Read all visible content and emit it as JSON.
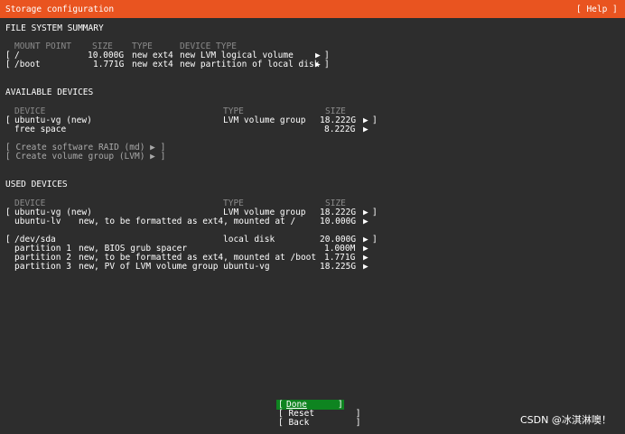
{
  "header": {
    "title": "Storage configuration",
    "help_label": "[ Help ]"
  },
  "fs_summary": {
    "heading": "FILE SYSTEM SUMMARY",
    "col_mount": "MOUNT POINT",
    "col_size": "SIZE",
    "col_type": "TYPE",
    "col_device_type": "DEVICE TYPE",
    "rows": [
      {
        "bracket_open": "[",
        "mount": "/",
        "size": "10.000G",
        "type": "new ext4",
        "device_type": "new LVM logical volume",
        "arrow": "▶",
        "bracket_close": "]"
      },
      {
        "bracket_open": "[",
        "mount": "/boot",
        "size": "1.771G",
        "type": "new ext4",
        "device_type": "new partition of local disk",
        "arrow": "▶",
        "bracket_close": "]"
      }
    ]
  },
  "available": {
    "heading": "AVAILABLE DEVICES",
    "col_device": "DEVICE",
    "col_type": "TYPE",
    "col_size": "SIZE",
    "rows": [
      {
        "bracket_open": "[",
        "device": "ubuntu-vg (new)",
        "type": "LVM volume group",
        "size": "18.222G",
        "arrow": "▶",
        "bracket_close": "]"
      },
      {
        "device": "free space",
        "size": "8.222G",
        "arrow": "▶"
      }
    ],
    "create_raid": "[ Create software RAID (md) ▶ ]",
    "create_vg": "[ Create volume group (LVM) ▶ ]"
  },
  "used": {
    "heading": "USED DEVICES",
    "col_device": "DEVICE",
    "col_type": "TYPE",
    "col_size": "SIZE",
    "vg_row": {
      "bracket_open": "[",
      "device": "ubuntu-vg (new)",
      "type": "LVM volume group",
      "size": "18.222G",
      "arrow": "▶",
      "bracket_close": "]"
    },
    "lv_row": {
      "device": "ubuntu-lv",
      "desc": "new, to be formatted as ext4, mounted at /",
      "size": "10.000G",
      "arrow": "▶"
    },
    "disk_row": {
      "bracket_open": "[",
      "device": "/dev/sda",
      "type": "local disk",
      "size": "20.000G",
      "arrow": "▶",
      "bracket_close": "]"
    },
    "partitions": [
      {
        "name": "partition 1",
        "desc": "new, BIOS grub spacer",
        "size": "1.000M",
        "arrow": "▶"
      },
      {
        "name": "partition 2",
        "desc": "new, to be formatted as ext4, mounted at /boot",
        "size": "1.771G",
        "arrow": "▶"
      },
      {
        "name": "partition 3",
        "desc": "new, PV of LVM volume group ubuntu-vg",
        "size": "18.225G",
        "arrow": "▶"
      }
    ]
  },
  "buttons": {
    "done_open": "[",
    "done_label": "Done",
    "done_close": "]",
    "reset": "[ Reset        ]",
    "back": "[ Back         ]"
  },
  "watermark": "CSDN @冰淇淋噢！"
}
